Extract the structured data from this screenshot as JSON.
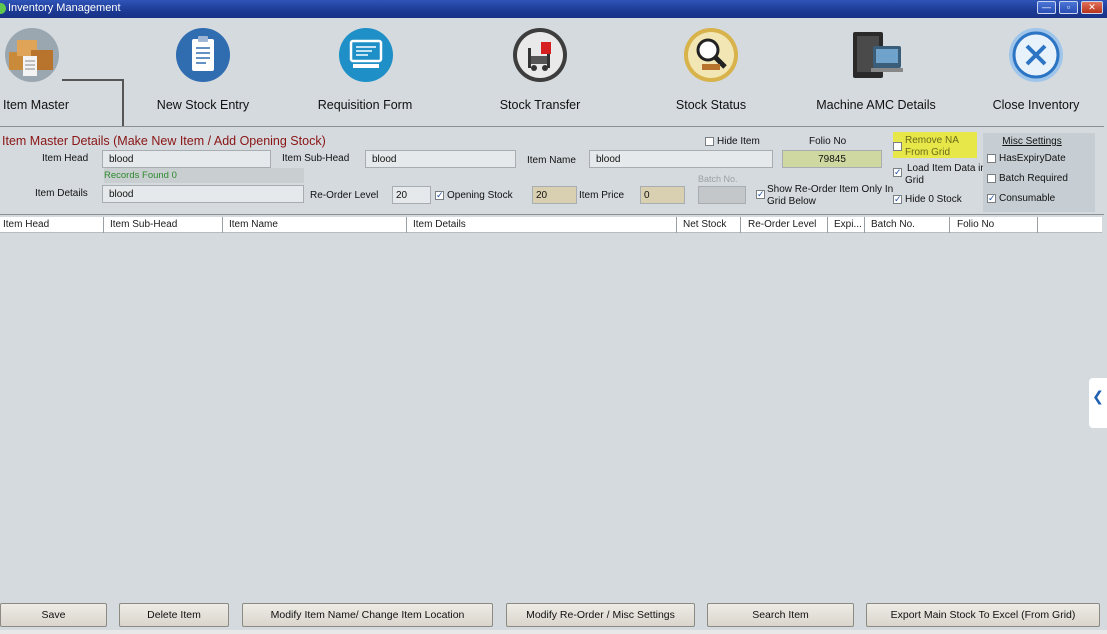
{
  "window": {
    "title": "Inventory Management",
    "minimize": "—",
    "restore": "▫",
    "close": "✕"
  },
  "toolbar": [
    {
      "label": "Item Master",
      "icon": "boxes-icon"
    },
    {
      "label": "New Stock Entry",
      "icon": "clipboard-icon"
    },
    {
      "label": "Requisition Form",
      "icon": "presentation-icon"
    },
    {
      "label": "Stock Transfer",
      "icon": "forklift-icon"
    },
    {
      "label": "Stock Status",
      "icon": "magnifier-icon"
    },
    {
      "label": "Machine AMC Details",
      "icon": "machine-icon"
    },
    {
      "label": "Close Inventory",
      "icon": "close-circle-icon"
    }
  ],
  "details": {
    "section_title": "Item Master Details (Make New Item / Add Opening Stock)",
    "item_head_label": "Item Head",
    "item_head_value": "blood",
    "item_subhead_label": "Item Sub-Head",
    "item_subhead_value": "blood",
    "item_name_label": "Item Name",
    "item_name_value": "blood",
    "records_found": "Records Found 0",
    "item_details_label": "Item Details",
    "item_details_value": "blood",
    "reorder_level_label": "Re-Order Level",
    "reorder_level_value": "20",
    "opening_stock_label": "Opening Stock",
    "opening_stock_value": "20",
    "item_price_label": "Item Price",
    "item_price_value": "0",
    "batch_no_label": "Batch No.",
    "batch_no_value": "",
    "hide_item_label": "Hide Item",
    "folio_no_label": "Folio No",
    "folio_no_value": "79845",
    "show_reorder_label_1": "Show Re-Order Item Only In",
    "show_reorder_label_2": "Grid Below",
    "remove_na_label_1": "Remove NA",
    "remove_na_label_2": "From Grid",
    "load_item_label_1": "Load Item Data in",
    "load_item_label_2": "Grid",
    "hide_zero_label": "Hide 0 Stock"
  },
  "misc": {
    "title": "Misc Settings",
    "has_expiry_label": "HasExpiryDate",
    "batch_required_label": "Batch Required",
    "consumable_label": "Consumable"
  },
  "checkboxes": {
    "hide_item": false,
    "opening_stock": true,
    "show_reorder": true,
    "remove_na": false,
    "load_item": true,
    "hide_zero": true,
    "has_expiry": false,
    "batch_required": false,
    "consumable": true
  },
  "grid": {
    "columns": [
      "Item Head",
      "Item Sub-Head",
      "Item Name",
      "Item Details",
      "Net Stock",
      "Re-Order Level",
      "Expi...",
      "Batch No.",
      "Folio No"
    ],
    "rows": []
  },
  "side_tab": "❮",
  "buttons": {
    "save": "Save",
    "delete_item": "Delete Item",
    "modify_name": "Modify Item Name/ Change Item Location",
    "modify_reorder": "Modify Re-Order / Misc Settings",
    "search_item": "Search Item",
    "export": "Export Main Stock To Excel (From Grid)"
  },
  "colors": {
    "title_bar": "#1c3a94",
    "section_title": "#8a1414",
    "records_found": "#2e8b2e",
    "highlight_yellow": "#e7e74a",
    "folio_green": "#cfd8a0"
  }
}
